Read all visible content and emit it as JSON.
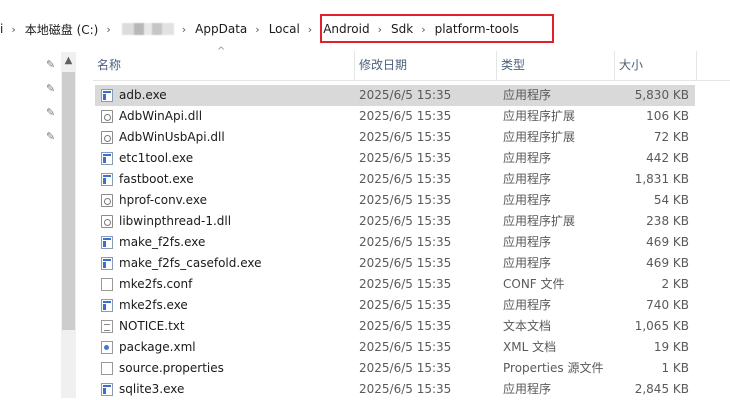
{
  "breadcrumb": {
    "leading": "i",
    "items": [
      "本地磁盘 (C:)",
      "",
      "AppData",
      "Local",
      "Android",
      "Sdk",
      "platform-tools"
    ]
  },
  "columns": {
    "name": "名称",
    "date": "修改日期",
    "type": "类型",
    "size": "大小"
  },
  "files": [
    {
      "name": "adb.exe",
      "date": "2025/6/5 15:35",
      "type": "应用程序",
      "size": "5,830 KB",
      "icon": "exe-icon",
      "selected": true
    },
    {
      "name": "AdbWinApi.dll",
      "date": "2025/6/5 15:35",
      "type": "应用程序扩展",
      "size": "106 KB",
      "icon": "dll-icon"
    },
    {
      "name": "AdbWinUsbApi.dll",
      "date": "2025/6/5 15:35",
      "type": "应用程序扩展",
      "size": "72 KB",
      "icon": "dll-icon"
    },
    {
      "name": "etc1tool.exe",
      "date": "2025/6/5 15:35",
      "type": "应用程序",
      "size": "442 KB",
      "icon": "exe-icon"
    },
    {
      "name": "fastboot.exe",
      "date": "2025/6/5 15:35",
      "type": "应用程序",
      "size": "1,831 KB",
      "icon": "exe-icon"
    },
    {
      "name": "hprof-conv.exe",
      "date": "2025/6/5 15:35",
      "type": "应用程序",
      "size": "54 KB",
      "icon": "dll-icon"
    },
    {
      "name": "libwinpthread-1.dll",
      "date": "2025/6/5 15:35",
      "type": "应用程序扩展",
      "size": "238 KB",
      "icon": "dll-icon"
    },
    {
      "name": "make_f2fs.exe",
      "date": "2025/6/5 15:35",
      "type": "应用程序",
      "size": "469 KB",
      "icon": "exe-icon"
    },
    {
      "name": "make_f2fs_casefold.exe",
      "date": "2025/6/5 15:35",
      "type": "应用程序",
      "size": "469 KB",
      "icon": "exe-icon"
    },
    {
      "name": "mke2fs.conf",
      "date": "2025/6/5 15:35",
      "type": "CONF 文件",
      "size": "2 KB",
      "icon": "doc-icon"
    },
    {
      "name": "mke2fs.exe",
      "date": "2025/6/5 15:35",
      "type": "应用程序",
      "size": "740 KB",
      "icon": "exe-icon"
    },
    {
      "name": "NOTICE.txt",
      "date": "2025/6/5 15:35",
      "type": "文本文档",
      "size": "1,065 KB",
      "icon": "txt-icon"
    },
    {
      "name": "package.xml",
      "date": "2025/6/5 15:35",
      "type": "XML 文档",
      "size": "19 KB",
      "icon": "xml-icon"
    },
    {
      "name": "source.properties",
      "date": "2025/6/5 15:35",
      "type": "Properties 源文件",
      "size": "1 KB",
      "icon": "doc-icon"
    },
    {
      "name": "sqlite3.exe",
      "date": "2025/6/5 15:35",
      "type": "应用程序",
      "size": "2,845 KB",
      "icon": "exe-icon"
    }
  ],
  "nav": {
    "pins": 4
  },
  "colors": {
    "highlight_border": "#e0202a",
    "selected_row": "#d9d9d9",
    "header_text": "#4c607a"
  }
}
